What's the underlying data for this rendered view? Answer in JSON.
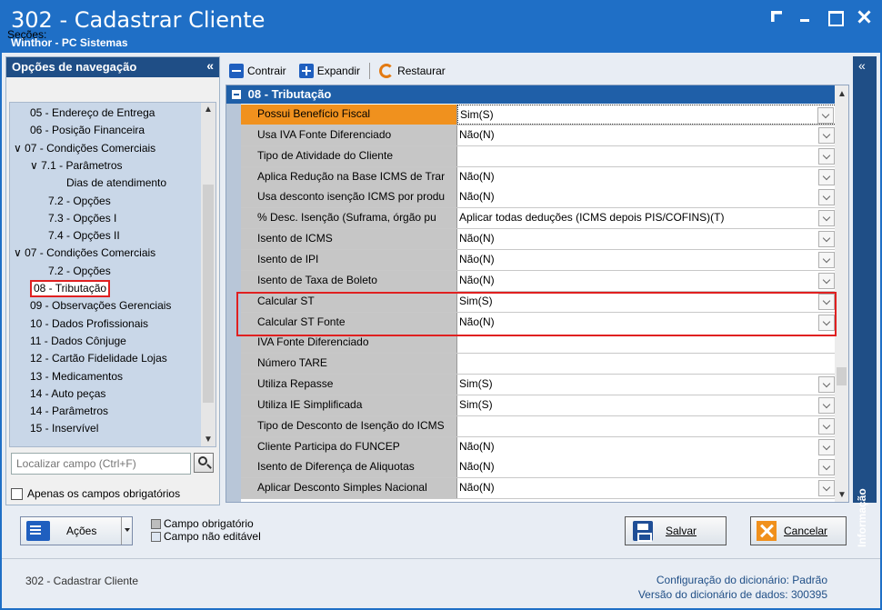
{
  "window": {
    "title": "302 - Cadastrar Cliente",
    "subtitle": "Winthor - PC Sistemas"
  },
  "nav": {
    "header": "Opções de navegação",
    "collapse_glyph": "«",
    "sections_label": "Seções:",
    "items": [
      {
        "label": "05 - Endereço de Entrega",
        "level": 1
      },
      {
        "label": "06 - Posição Financeira",
        "level": 1
      },
      {
        "label": "07 - Condições Comerciais",
        "level": 0,
        "expanded": true
      },
      {
        "label": "7.1 - Parâmetros",
        "level": 1,
        "expanded": true
      },
      {
        "label": "Dias de atendimento",
        "level": 3
      },
      {
        "label": "7.2 - Opções",
        "level": 2
      },
      {
        "label": "7.3 - Opções I",
        "level": 2
      },
      {
        "label": "7.4 - Opções II",
        "level": 2
      },
      {
        "label": "07 - Condições Comerciais",
        "level": 0,
        "expanded": true
      },
      {
        "label": "7.2 - Opções",
        "level": 2
      },
      {
        "label": "08 - Tributação",
        "level": 1,
        "selected": true
      },
      {
        "label": "09 - Observações Gerenciais",
        "level": 1
      },
      {
        "label": "10 - Dados Profissionais",
        "level": 1
      },
      {
        "label": "11 - Dados Cônjuge",
        "level": 1
      },
      {
        "label": "12 - Cartão Fidelidade Lojas",
        "level": 1
      },
      {
        "label": "13 - Medicamentos",
        "level": 1
      },
      {
        "label": "14 - Auto peças",
        "level": 1
      },
      {
        "label": "14 - Parâmetros",
        "level": 1
      },
      {
        "label": "15 - Inservível",
        "level": 1
      }
    ],
    "search_placeholder": "Localizar campo (Ctrl+F)",
    "required_only_label": "Apenas os campos obrigatórios"
  },
  "toolbar": {
    "collapse_label": "Contrair",
    "expand_label": "Expandir",
    "restore_label": "Restaurar"
  },
  "grid": {
    "group_title": "08 - Tributação",
    "rows": [
      {
        "label": "Possui Benefício Fiscal",
        "value": "Sim(S)",
        "dropdown": true,
        "highlight": true
      },
      {
        "label": "Usa IVA Fonte Diferenciado",
        "value": "Não(N)",
        "dropdown": true
      },
      {
        "label": "Tipo de Atividade do Cliente",
        "value": "",
        "dropdown": true
      },
      {
        "label": "Aplica Redução na Base ICMS de Trar",
        "value": "Não(N)",
        "dropdown": true
      },
      {
        "label": "Usa desconto isenção ICMS por produ",
        "value": "Não(N)",
        "dropdown": true
      },
      {
        "label": "% Desc. Isenção (Suframa, órgão pu",
        "value": "Aplicar todas deduções (ICMS depois PIS/COFINS)(T)",
        "dropdown": true
      },
      {
        "label": "Isento de ICMS",
        "value": "Não(N)",
        "dropdown": true
      },
      {
        "label": "Isento de IPI",
        "value": "Não(N)",
        "dropdown": true
      },
      {
        "label": "Isento de Taxa de Boleto",
        "value": "Não(N)",
        "dropdown": true
      },
      {
        "label": "Calcular ST",
        "value": "Sim(S)",
        "dropdown": true
      },
      {
        "label": "Calcular ST Fonte",
        "value": "Não(N)",
        "dropdown": true
      },
      {
        "label": "IVA Fonte Diferenciado",
        "value": "",
        "dropdown": false
      },
      {
        "label": "Número TARE",
        "value": "",
        "dropdown": false
      },
      {
        "label": "Utiliza Repasse",
        "value": "Sim(S)",
        "dropdown": true
      },
      {
        "label": "Utiliza IE Simplificada",
        "value": "Sim(S)",
        "dropdown": true
      },
      {
        "label": "Tipo de Desconto de Isenção do ICMS",
        "value": "",
        "dropdown": true
      },
      {
        "label": "Cliente Participa do FUNCEP",
        "value": "Não(N)",
        "dropdown": true
      },
      {
        "label": "Isento de Diferença de Aliquotas",
        "value": "Não(N)",
        "dropdown": true
      },
      {
        "label": "Aplicar Desconto Simples Nacional",
        "value": "Não(N)",
        "dropdown": true
      }
    ]
  },
  "info_tab": {
    "label": "Informação",
    "collapse_glyph": "«"
  },
  "bottom": {
    "actions_label": "Ações",
    "legend_required": "Campo obrigatório",
    "legend_not_editable": "Campo não editável",
    "save_label": "Salvar",
    "cancel_label": "Cancelar"
  },
  "status": {
    "left": "302 - Cadastrar Cliente",
    "dict_config_label": "Configuração do dicionário:",
    "dict_config_value": "Padrão",
    "dict_version_label": "Versão do dicionário de dados:",
    "dict_version_value": "300395"
  },
  "colors": {
    "titlebar": "#1f6fc6",
    "nav_header": "#1f4e86",
    "highlight_row": "#f0911e",
    "annotation_red": "#e02020"
  }
}
